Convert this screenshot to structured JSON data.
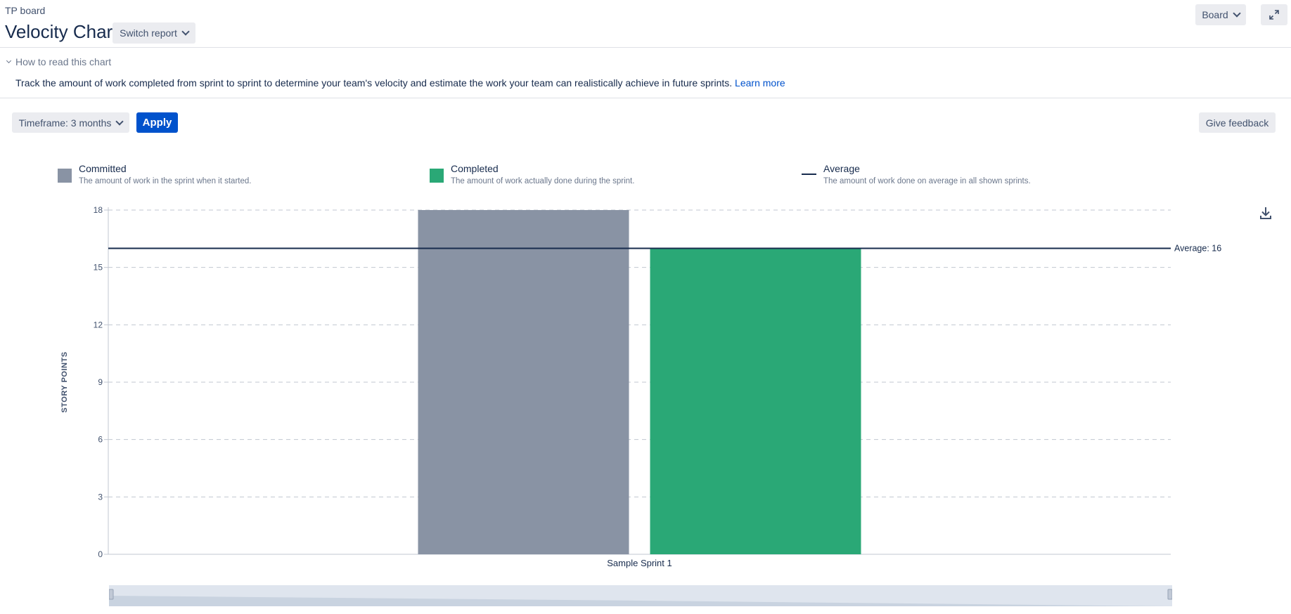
{
  "header": {
    "breadcrumb": "TP board",
    "title": "Velocity Chart",
    "switch_report_label": "Switch report",
    "board_label": "Board"
  },
  "info": {
    "how_to_label": "How to read this chart",
    "description": "Track the amount of work completed from sprint to sprint to determine your team's velocity and estimate the work your team can realistically achieve in future sprints.",
    "learn_more_label": "Learn more"
  },
  "controls": {
    "timeframe_label": "Timeframe: 3 months",
    "apply_label": "Apply",
    "feedback_label": "Give feedback"
  },
  "legend": [
    {
      "title": "Committed",
      "description": "The amount of work in the sprint when it started.",
      "color": "#8993a4",
      "kind": "box"
    },
    {
      "title": "Completed",
      "description": "The amount of work actually done during the sprint.",
      "color": "#2aa876",
      "kind": "box"
    },
    {
      "title": "Average",
      "description": "The amount of work done on average in all shown sprints.",
      "color": "#172b4d",
      "kind": "line"
    }
  ],
  "icons": {
    "download": "download-icon",
    "expand": "expand-icon"
  },
  "chart_data": {
    "type": "bar",
    "categories": [
      "Sample Sprint 1"
    ],
    "series": [
      {
        "name": "Committed",
        "values": [
          18
        ],
        "color": "#8993a4"
      },
      {
        "name": "Completed",
        "values": [
          16
        ],
        "color": "#2aa876"
      }
    ],
    "average": {
      "value": 16,
      "label": "Average: 16"
    },
    "ylabel": "STORY POINTS",
    "ylim": [
      0,
      18
    ],
    "yticks": [
      0,
      3,
      6,
      9,
      12,
      15,
      18
    ],
    "grid": true
  }
}
